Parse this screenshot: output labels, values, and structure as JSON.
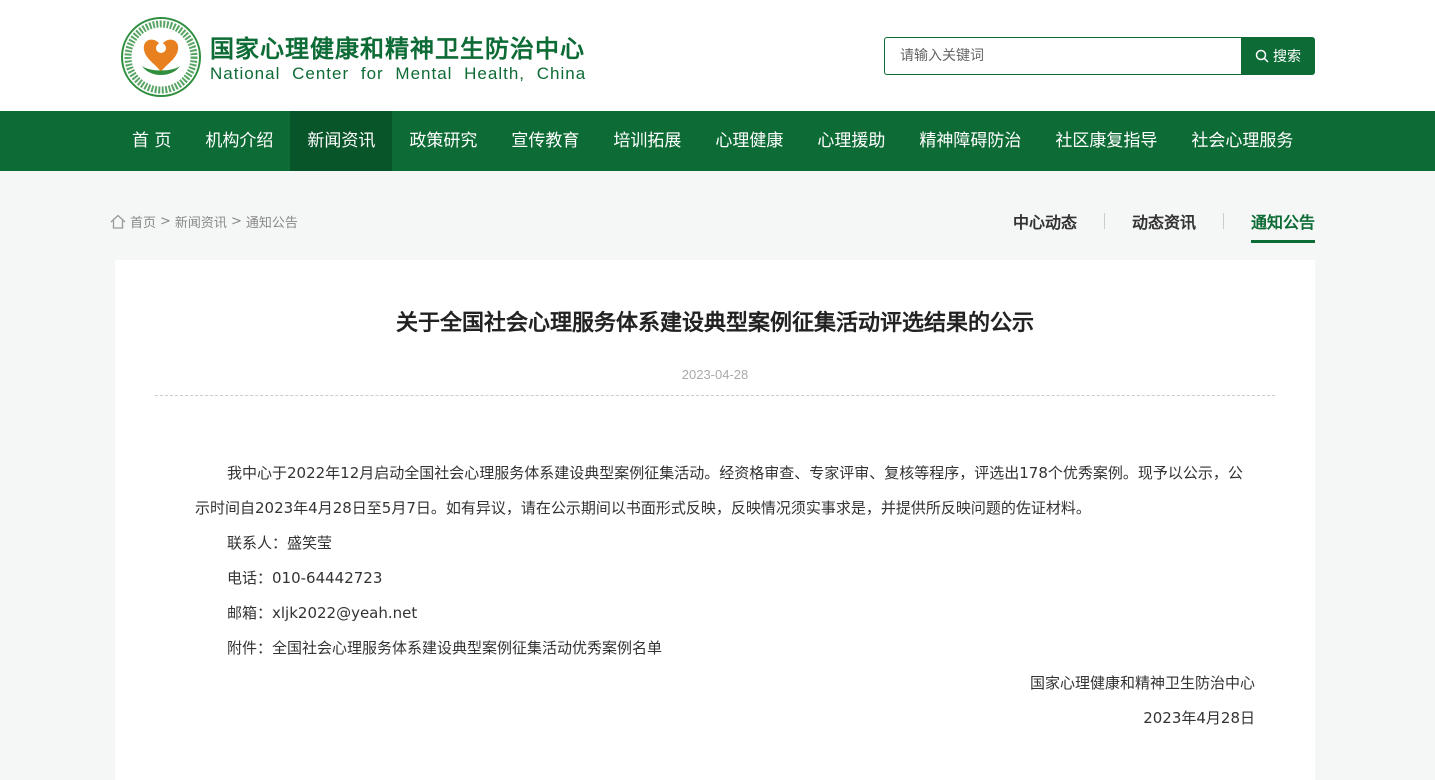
{
  "header": {
    "brand_cn": "国家心理健康和精神卫生防治中心",
    "brand_en": "National Center for Mental Health, China",
    "search_placeholder": "请输入关键词",
    "search_button": "搜索"
  },
  "nav": {
    "items": [
      "首 页",
      "机构介绍",
      "新闻资讯",
      "政策研究",
      "宣传教育",
      "培训拓展",
      "心理健康",
      "心理援助",
      "精神障碍防治",
      "社区康复指导",
      "社会心理服务"
    ],
    "active_index": 2
  },
  "breadcrumb": {
    "home": "首页",
    "sep1": ">",
    "level1": "新闻资讯",
    "sep2": ">",
    "level2": "通知公告"
  },
  "tabs": [
    {
      "label": "中心动态",
      "active": false
    },
    {
      "label": "动态资讯",
      "active": false
    },
    {
      "label": "通知公告",
      "active": true
    }
  ],
  "article": {
    "title": "关于全国社会心理服务体系建设典型案例征集活动评选结果的公示",
    "date": "2023-04-28",
    "paragraph": "我中心于2022年12月启动全国社会心理服务体系建设典型案例征集活动。经资格审查、专家评审、复核等程序，评选出178个优秀案例。现予以公示，公示时间自2023年4月28日至5月7日。如有异议，请在公示期间以书面形式反映，反映情况须实事求是，并提供所反映问题的佐证材料。",
    "contact": "联系人：盛笑莹",
    "phone": "电话：010-64442723",
    "email": "邮箱：xljk2022@yeah.net",
    "attachment_prefix": "附件：",
    "attachment_link": "全国社会心理服务体系建设典型案例征集活动优秀案例名单",
    "signature": "国家心理健康和精神卫生防治中心",
    "sign_date": "2023年4月28日"
  },
  "colors": {
    "primary": "#0d6b35",
    "nav_active": "#09552a",
    "page_bg": "#f5f7f6"
  }
}
